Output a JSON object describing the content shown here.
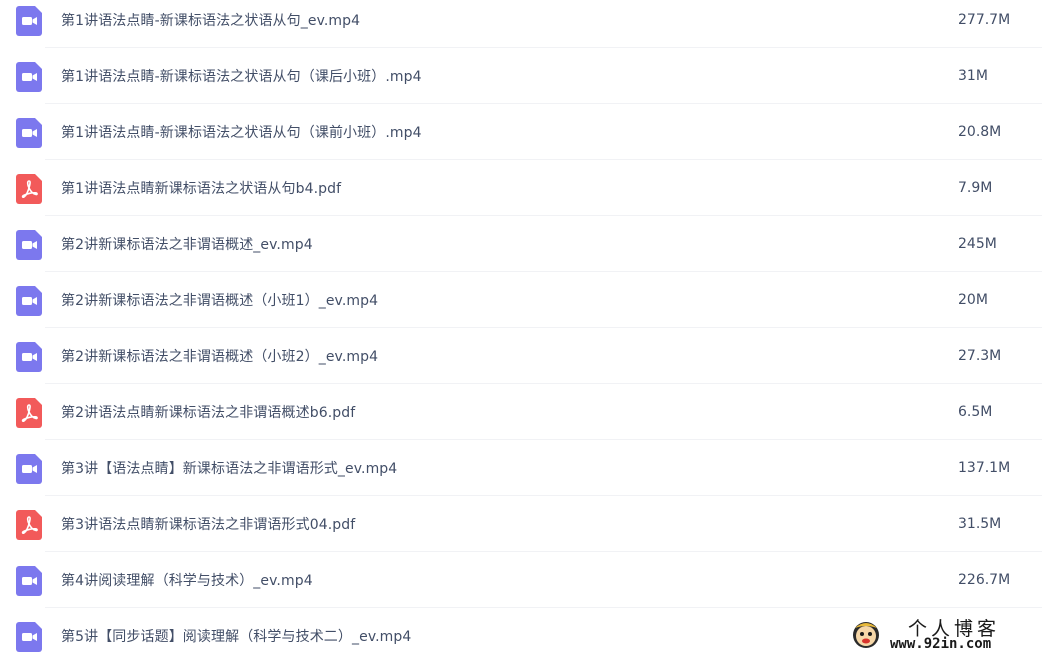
{
  "files": [
    {
      "name": "第1讲语法点睛-新课标语法之状语从句_ev.mp4",
      "size": "277.7M",
      "type": "video",
      "icon": "video-file-icon"
    },
    {
      "name": "第1讲语法点睛-新课标语法之状语从句（课后小班）.mp4",
      "size": "31M",
      "type": "video",
      "icon": "video-file-icon"
    },
    {
      "name": "第1讲语法点睛-新课标语法之状语从句（课前小班）.mp4",
      "size": "20.8M",
      "type": "video",
      "icon": "video-file-icon"
    },
    {
      "name": "第1讲语法点睛新课标语法之状语从句b4.pdf",
      "size": "7.9M",
      "type": "pdf",
      "icon": "pdf-file-icon"
    },
    {
      "name": "第2讲新课标语法之非谓语概述_ev.mp4",
      "size": "245M",
      "type": "video",
      "icon": "video-file-icon"
    },
    {
      "name": "第2讲新课标语法之非谓语概述（小班1）_ev.mp4",
      "size": "20M",
      "type": "video",
      "icon": "video-file-icon"
    },
    {
      "name": "第2讲新课标语法之非谓语概述（小班2）_ev.mp4",
      "size": "27.3M",
      "type": "video",
      "icon": "video-file-icon"
    },
    {
      "name": "第2讲语法点睛新课标语法之非谓语概述b6.pdf",
      "size": "6.5M",
      "type": "pdf",
      "icon": "pdf-file-icon"
    },
    {
      "name": "第3讲【语法点睛】新课标语法之非谓语形式_ev.mp4",
      "size": "137.1M",
      "type": "video",
      "icon": "video-file-icon"
    },
    {
      "name": "第3讲语法点睛新课标语法之非谓语形式04.pdf",
      "size": "31.5M",
      "type": "pdf",
      "icon": "pdf-file-icon"
    },
    {
      "name": "第4讲阅读理解（科学与技术）_ev.mp4",
      "size": "226.7M",
      "type": "video",
      "icon": "video-file-icon"
    },
    {
      "name": "第5讲【同步话题】阅读理解（科学与技术二）_ev.mp4",
      "size": "",
      "type": "video",
      "icon": "video-file-icon"
    }
  ],
  "colors": {
    "video_icon": "#7c78ee",
    "pdf_icon": "#f25a5a",
    "text": "#424e67",
    "divider": "#f1f2f5"
  },
  "watermark": {
    "title": "个人博客",
    "url": "www.92in.com",
    "icon": "mascot-logo-icon"
  }
}
